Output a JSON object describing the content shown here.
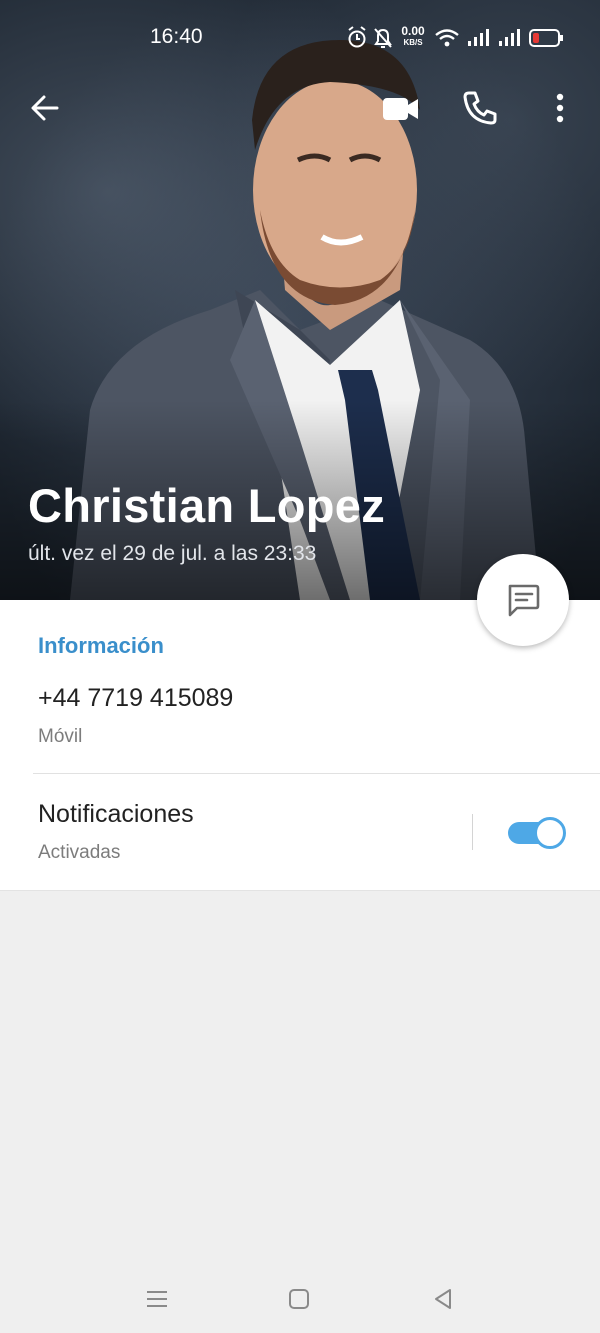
{
  "status_bar": {
    "time": "16:40",
    "net_speed_value": "0.00",
    "net_speed_unit": "KB/S",
    "icons": [
      "alarm-icon",
      "mute-bell-icon",
      "wifi-icon",
      "signal-icon",
      "signal-icon",
      "battery-low-icon"
    ]
  },
  "top_bar": {
    "icons": [
      "back-arrow-icon",
      "video-call-icon",
      "phone-call-icon",
      "more-vertical-icon"
    ]
  },
  "profile": {
    "name": "Christian Lopez",
    "last_seen": "últ. vez el 29 de jul. a las 23:33"
  },
  "info": {
    "section_title": "Información",
    "phone": "+44 7719 415089",
    "phone_label": "Móvil"
  },
  "notifications": {
    "title": "Notificaciones",
    "status": "Activadas",
    "enabled": true
  },
  "fab": {
    "icon": "message-icon"
  },
  "nav_bar": {
    "icons": [
      "recents-icon",
      "home-icon",
      "back-icon"
    ]
  },
  "colors": {
    "accent": "#3a8fcb",
    "toggle": "#4ea8e6",
    "battery_low": "#e53935"
  }
}
